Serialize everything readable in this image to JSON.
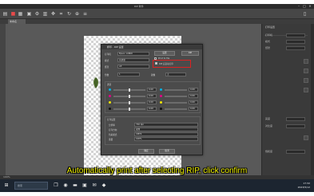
{
  "window": {
    "title": "RIP 軟件",
    "min": "–",
    "max": "□",
    "close": "✕"
  },
  "toolbar": {
    "icons": [
      "open-icon",
      "save-icon",
      "import-icon",
      "print-icon",
      "settings-icon",
      "grid-icon",
      "move-icon",
      "crop-icon",
      "rotate-icon",
      "zoom-icon",
      "layers-icon"
    ]
  },
  "document": {
    "tab_label": "未命名"
  },
  "right_panel": {
    "title": "打印设置",
    "rows": [
      "打印机",
      "模式",
      "纸张",
      "",
      "",
      "",
      "",
      "亮度",
      "对比度",
      "",
      "",
      "饱和度"
    ]
  },
  "status": {
    "zoom": "100%"
  },
  "dialog": {
    "title": "打印 · RIP 设置",
    "fields": [
      {
        "label": "打印机",
        "value": "Epson L1800"
      },
      {
        "label": "模式",
        "value": "高质量"
      },
      {
        "label": "纸张",
        "value": "A3"
      }
    ],
    "buttons": {
      "settings": "设置",
      "rip": "RIP",
      "ok": "确定",
      "cancel": "取消"
    },
    "checks": {
      "print_to_file": "Print to file",
      "auto_print_after_rip": "RIP 后自动打印"
    },
    "copies": {
      "label": "份数",
      "value": "1",
      "mirror_label": "镜像",
      "mirror_value": "无"
    },
    "channels_title": "通道",
    "channels": [
      {
        "name": "C",
        "value": "0.00"
      },
      {
        "name": "M",
        "value": "0.00"
      },
      {
        "name": "Y",
        "value": "0.00"
      },
      {
        "name": "K",
        "value": "0.00"
      }
    ],
    "channel_colors": [
      "#00b4e6",
      "#e6008a",
      "#f2e600",
      "#111111"
    ],
    "settings_title": "打印设置",
    "settings": [
      {
        "label": "分辨率",
        "value": "720 dpi"
      },
      {
        "label": "打印方向",
        "value": "双向"
      },
      {
        "label": "色彩模式",
        "value": "CMYK"
      },
      {
        "label": "墨量",
        "value": "100%"
      }
    ]
  },
  "subtitle": "Automatically print after selecting RIP, click confirm",
  "taskbar": {
    "search_placeholder": "搜索",
    "time": "17:32",
    "date": "2023/5/12",
    "icons": [
      "windows-icon",
      "task-view-icon",
      "edge-icon",
      "explorer-icon",
      "store-icon",
      "mail-icon",
      "app-icon"
    ]
  }
}
